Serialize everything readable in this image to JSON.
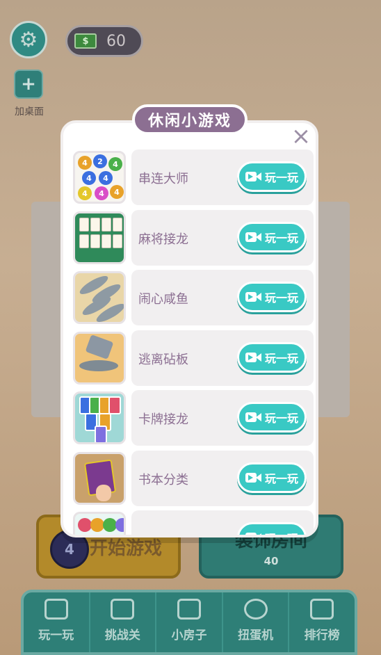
{
  "background": {
    "coins": "60",
    "bill_symbol": "$",
    "add_desktop_label": "加桌面",
    "start_button_label": "开始游戏",
    "level_number": "4",
    "decorate_button_label": "装饰房间",
    "decorate_cost": "40",
    "tabs": [
      {
        "label": "玩一玩",
        "icon": "gamepad-icon"
      },
      {
        "label": "挑战关",
        "icon": "grid-icon"
      },
      {
        "label": "小房子",
        "icon": "house-icon"
      },
      {
        "label": "扭蛋机",
        "icon": "capsule-icon"
      },
      {
        "label": "排行榜",
        "icon": "podium-icon"
      }
    ]
  },
  "modal": {
    "title": "休闲小游戏",
    "close_icon": "close-icon",
    "play_label": "玩一玩",
    "games": [
      {
        "name": "串连大师",
        "thumb": "number-balls"
      },
      {
        "name": "麻将接龙",
        "thumb": "mahjong-tiles"
      },
      {
        "name": "闹心咸鱼",
        "thumb": "salted-fish"
      },
      {
        "name": "逃离砧板",
        "thumb": "cutting-board"
      },
      {
        "name": "卡牌接龙",
        "thumb": "card-solitaire"
      },
      {
        "name": "书本分类",
        "thumb": "book-sort"
      },
      {
        "name": "",
        "thumb": "color-balls"
      }
    ]
  },
  "colors": {
    "accent": "#39c9c4",
    "title_bg": "#8c6f92",
    "name_text": "#8c6f92"
  }
}
